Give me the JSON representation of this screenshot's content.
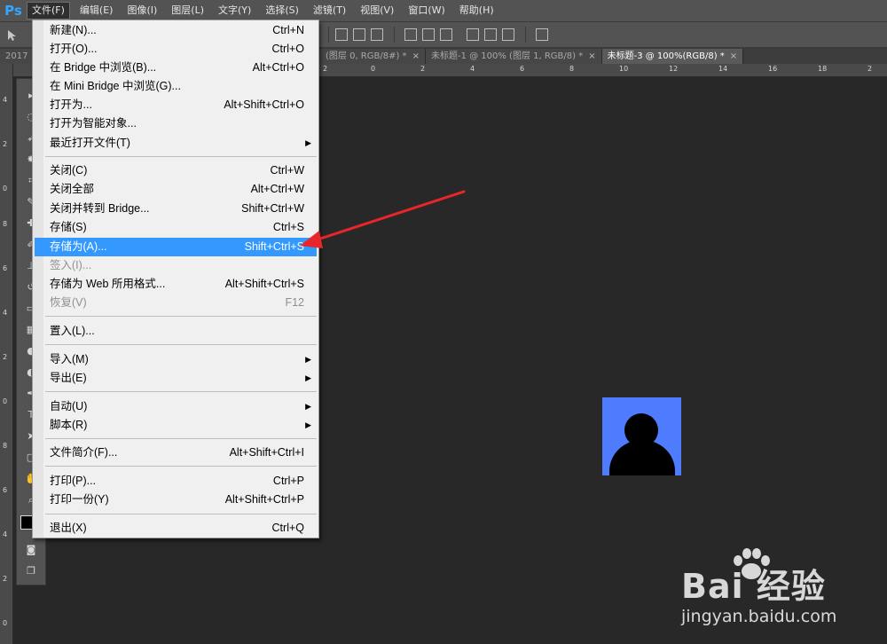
{
  "app": {
    "logo": "Ps"
  },
  "menubar": [
    {
      "label": "文件(F)",
      "active": true
    },
    {
      "label": "编辑(E)"
    },
    {
      "label": "图像(I)"
    },
    {
      "label": "图层(L)"
    },
    {
      "label": "文字(Y)"
    },
    {
      "label": "选择(S)"
    },
    {
      "label": "滤镜(T)"
    },
    {
      "label": "视图(V)"
    },
    {
      "label": "窗口(W)"
    },
    {
      "label": "帮助(H)"
    }
  ],
  "tabs": [
    {
      "label": "2017"
    },
    {
      "label": "(图层 0, RGB/8#) *"
    },
    {
      "label": "未标题-1 @ 100% (图层 1, RGB/8) *"
    },
    {
      "label": "未标题-3 @ 100%(RGB/8) *",
      "active": true
    }
  ],
  "tab_close": "×",
  "ruler_top": [
    "2",
    "0",
    "2",
    "4",
    "6",
    "8",
    "10",
    "12",
    "14",
    "16",
    "18",
    "2"
  ],
  "ruler_left": [
    "4",
    "2",
    "0",
    "8",
    "6",
    "4",
    "2",
    "0",
    "8",
    "6",
    "4",
    "2",
    "0"
  ],
  "file_menu": {
    "items": [
      {
        "label": "新建(N)...",
        "shortcut": "Ctrl+N"
      },
      {
        "label": "打开(O)...",
        "shortcut": "Ctrl+O"
      },
      {
        "label": "在 Bridge 中浏览(B)...",
        "shortcut": "Alt+Ctrl+O"
      },
      {
        "label": "在 Mini Bridge 中浏览(G)...",
        "shortcut": ""
      },
      {
        "label": "打开为...",
        "shortcut": "Alt+Shift+Ctrl+O"
      },
      {
        "label": "打开为智能对象...",
        "shortcut": ""
      },
      {
        "label": "最近打开文件(T)",
        "shortcut": "",
        "submenu": true
      },
      {
        "label": "关闭(C)",
        "shortcut": "Ctrl+W"
      },
      {
        "label": "关闭全部",
        "shortcut": "Alt+Ctrl+W"
      },
      {
        "label": "关闭并转到 Bridge...",
        "shortcut": "Shift+Ctrl+W"
      },
      {
        "label": "存储(S)",
        "shortcut": "Ctrl+S"
      },
      {
        "label": "存储为(A)...",
        "shortcut": "Shift+Ctrl+S",
        "highlight": true
      },
      {
        "label": "签入(I)...",
        "shortcut": "",
        "disabled": true
      },
      {
        "label": "存储为 Web 所用格式...",
        "shortcut": "Alt+Shift+Ctrl+S"
      },
      {
        "label": "恢复(V)",
        "shortcut": "F12",
        "disabled": true
      },
      {
        "label": "置入(L)...",
        "shortcut": ""
      },
      {
        "label": "导入(M)",
        "shortcut": "",
        "submenu": true
      },
      {
        "label": "导出(E)",
        "shortcut": "",
        "submenu": true
      },
      {
        "label": "自动(U)",
        "shortcut": "",
        "submenu": true
      },
      {
        "label": "脚本(R)",
        "shortcut": "",
        "submenu": true
      },
      {
        "label": "文件简介(F)...",
        "shortcut": "Alt+Shift+Ctrl+I"
      },
      {
        "label": "打印(P)...",
        "shortcut": "Ctrl+P"
      },
      {
        "label": "打印一份(Y)",
        "shortcut": "Alt+Shift+Ctrl+P"
      },
      {
        "label": "退出(X)",
        "shortcut": "Ctrl+Q"
      }
    ],
    "submenu_glyph": "▶"
  },
  "colors": {
    "highlight": "#3399ff",
    "document_fill": "#4f7cff",
    "arrow": "#e8252a"
  },
  "watermark": {
    "logo_text": "Bai  经验",
    "url": "jingyan.baidu.com"
  }
}
